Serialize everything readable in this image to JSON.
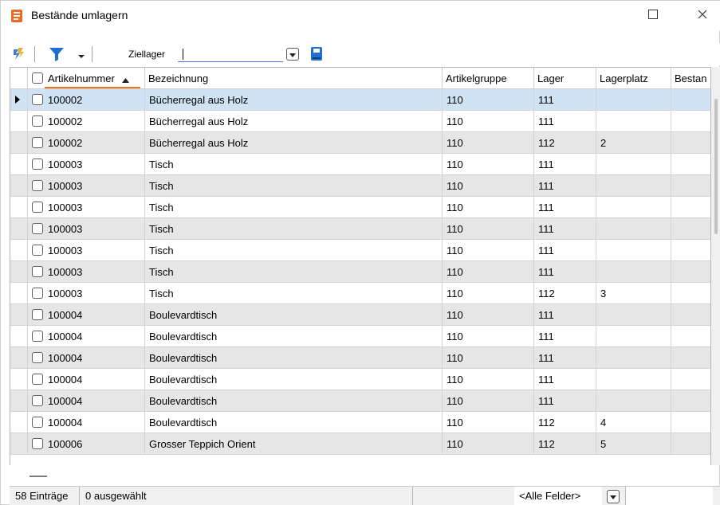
{
  "window": {
    "title": "Bestände umlagern",
    "icons": {
      "app": "app-document-icon",
      "maximize": "maximize-icon",
      "close": "close-icon"
    }
  },
  "toolbar": {
    "icons": [
      "lightning-icon",
      "filter-icon",
      "chevron-down-icon",
      "dropdown-arrow-icon",
      "book-icon"
    ],
    "ziellager_label": "Ziellager",
    "ziellager_value": ""
  },
  "grid": {
    "columns": [
      "Artikelnummer",
      "Bezeichnung",
      "Artikelgruppe",
      "Lager",
      "Lagerplatz",
      "Bestan"
    ],
    "sort_indicator": "sort-ascending-icon",
    "rows": [
      {
        "artikelnummer": "100002",
        "bezeichnung": "Bücherregal aus Holz",
        "artikelgruppe": "110",
        "lager": "111",
        "lagerplatz": "",
        "bestand": ""
      },
      {
        "artikelnummer": "100002",
        "bezeichnung": "Bücherregal aus Holz",
        "artikelgruppe": "110",
        "lager": "111",
        "lagerplatz": "",
        "bestand": ""
      },
      {
        "artikelnummer": "100002",
        "bezeichnung": "Bücherregal aus Holz",
        "artikelgruppe": "110",
        "lager": "112",
        "lagerplatz": "2",
        "bestand": ""
      },
      {
        "artikelnummer": "100003",
        "bezeichnung": "Tisch",
        "artikelgruppe": "110",
        "lager": "111",
        "lagerplatz": "",
        "bestand": ""
      },
      {
        "artikelnummer": "100003",
        "bezeichnung": "Tisch",
        "artikelgruppe": "110",
        "lager": "111",
        "lagerplatz": "",
        "bestand": ""
      },
      {
        "artikelnummer": "100003",
        "bezeichnung": "Tisch",
        "artikelgruppe": "110",
        "lager": "111",
        "lagerplatz": "",
        "bestand": ""
      },
      {
        "artikelnummer": "100003",
        "bezeichnung": "Tisch",
        "artikelgruppe": "110",
        "lager": "111",
        "lagerplatz": "",
        "bestand": ""
      },
      {
        "artikelnummer": "100003",
        "bezeichnung": "Tisch",
        "artikelgruppe": "110",
        "lager": "111",
        "lagerplatz": "",
        "bestand": ""
      },
      {
        "artikelnummer": "100003",
        "bezeichnung": "Tisch",
        "artikelgruppe": "110",
        "lager": "111",
        "lagerplatz": "",
        "bestand": ""
      },
      {
        "artikelnummer": "100003",
        "bezeichnung": "Tisch",
        "artikelgruppe": "110",
        "lager": "112",
        "lagerplatz": "3",
        "bestand": ""
      },
      {
        "artikelnummer": "100004",
        "bezeichnung": "Boulevardtisch",
        "artikelgruppe": "110",
        "lager": "111",
        "lagerplatz": "",
        "bestand": ""
      },
      {
        "artikelnummer": "100004",
        "bezeichnung": "Boulevardtisch",
        "artikelgruppe": "110",
        "lager": "111",
        "lagerplatz": "",
        "bestand": ""
      },
      {
        "artikelnummer": "100004",
        "bezeichnung": "Boulevardtisch",
        "artikelgruppe": "110",
        "lager": "111",
        "lagerplatz": "",
        "bestand": ""
      },
      {
        "artikelnummer": "100004",
        "bezeichnung": "Boulevardtisch",
        "artikelgruppe": "110",
        "lager": "111",
        "lagerplatz": "",
        "bestand": ""
      },
      {
        "artikelnummer": "100004",
        "bezeichnung": "Boulevardtisch",
        "artikelgruppe": "110",
        "lager": "111",
        "lagerplatz": "",
        "bestand": ""
      },
      {
        "artikelnummer": "100004",
        "bezeichnung": "Boulevardtisch",
        "artikelgruppe": "110",
        "lager": "112",
        "lagerplatz": "4",
        "bestand": ""
      },
      {
        "artikelnummer": "100006",
        "bezeichnung": "Grosser Teppich Orient",
        "artikelgruppe": "110",
        "lager": "112",
        "lagerplatz": "5",
        "bestand": ""
      }
    ]
  },
  "statusbar": {
    "count": "58 Einträge",
    "selected": "0 ausgewählt",
    "filter_field": "<Alle Felder>",
    "search_value": ""
  },
  "colors": {
    "selected_row": "#cfe3f5",
    "alt_row": "#e6e6e6",
    "sort_accent": "#e87722",
    "toolbar_blue": "#1f6fd1",
    "lightning": "#2a67c9"
  }
}
